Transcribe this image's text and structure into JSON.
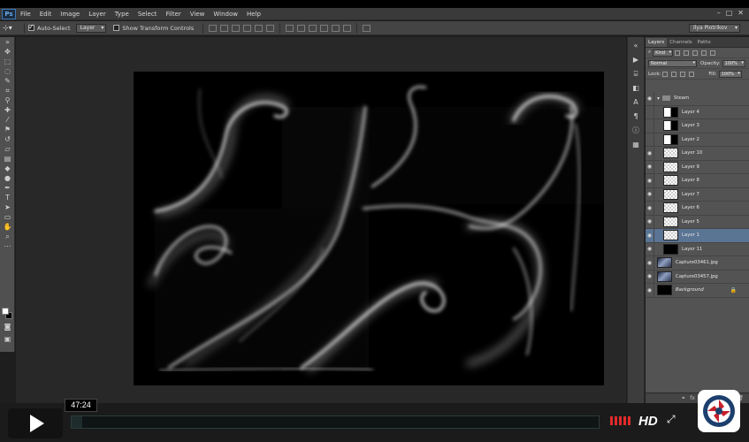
{
  "app": {
    "logo": "Ps",
    "menu": [
      "File",
      "Edit",
      "Image",
      "Layer",
      "Type",
      "Select",
      "Filter",
      "View",
      "Window",
      "Help"
    ],
    "window_controls": [
      "–",
      "□",
      "✕"
    ],
    "workspace": "Ilya Piotrikov"
  },
  "options_bar": {
    "auto_select_label": "Auto-Select",
    "auto_select_checked": true,
    "auto_select_target": "Layer",
    "show_transform_label": "Show Transform Controls",
    "show_transform_checked": false
  },
  "layers_panel": {
    "tabs": [
      "Layers",
      "Channels",
      "Paths"
    ],
    "kind_filter": "Kind",
    "blend_mode": "Normal",
    "opacity_label": "Opacity:",
    "opacity_value": "100%",
    "lock_label": "Lock:",
    "fill_label": "Fill:",
    "fill_value": "100%",
    "layers": [
      {
        "name": "Steam",
        "type": "group",
        "visible": true
      },
      {
        "name": "Layer 4",
        "type": "mixed",
        "visible": false,
        "indent": true
      },
      {
        "name": "Layer 3",
        "type": "mixed",
        "visible": false,
        "indent": true
      },
      {
        "name": "Layer 2",
        "type": "mixed",
        "visible": false,
        "indent": true
      },
      {
        "name": "Layer 10",
        "type": "transparent",
        "visible": true,
        "indent": true
      },
      {
        "name": "Layer 9",
        "type": "transparent",
        "visible": true,
        "indent": true
      },
      {
        "name": "Layer 8",
        "type": "transparent",
        "visible": true,
        "indent": true
      },
      {
        "name": "Layer 7",
        "type": "transparent",
        "visible": true,
        "indent": true
      },
      {
        "name": "Layer 6",
        "type": "transparent",
        "visible": true,
        "indent": true
      },
      {
        "name": "Layer 5",
        "type": "transparent",
        "visible": true,
        "indent": true
      },
      {
        "name": "Layer 1",
        "type": "transparent",
        "visible": true,
        "indent": true,
        "selected": true
      },
      {
        "name": "Layer 11",
        "type": "dark",
        "visible": true,
        "indent": true
      },
      {
        "name": "Capture03461.jpg",
        "type": "photo",
        "visible": true
      },
      {
        "name": "Capture03457.jpg",
        "type": "photo",
        "visible": true
      },
      {
        "name": "Background",
        "type": "dark",
        "visible": true,
        "italic": true,
        "locked": true
      }
    ],
    "footer_icons": [
      "link-icon",
      "fx-icon",
      "mask-icon",
      "adjustment-icon",
      "folder-icon",
      "new-layer-icon",
      "trash-icon"
    ]
  },
  "player": {
    "current_time": "47:24",
    "progress_fraction": 0.02,
    "hd_label": "HD",
    "fullscreen_glyph": "⤢"
  },
  "colors": {
    "ui_dark": "#3a3a3a",
    "panel": "#535353",
    "selection": "#5a7494",
    "volume": "#e22a2a"
  }
}
